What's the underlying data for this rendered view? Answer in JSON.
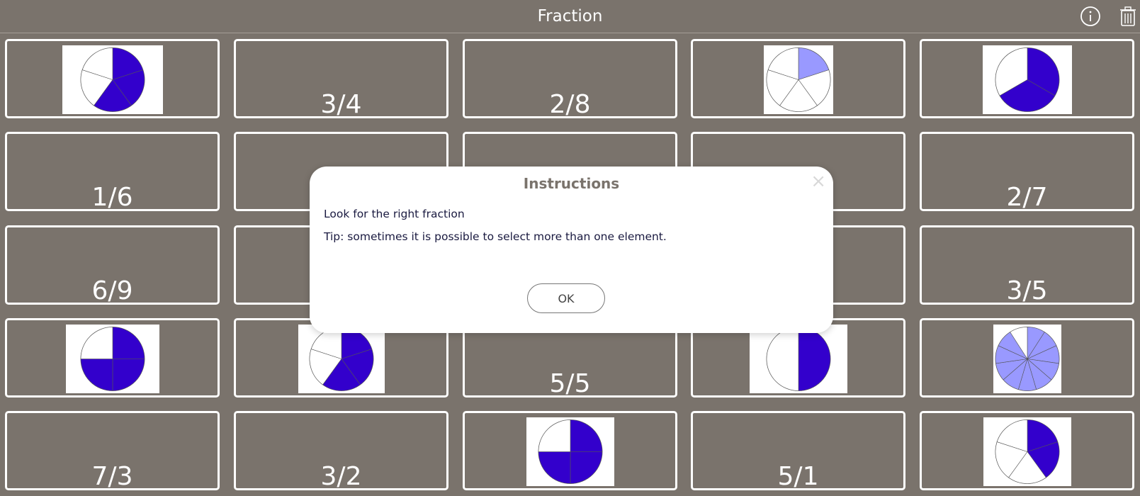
{
  "header": {
    "title": "Fraction",
    "info_icon": "info-icon",
    "trash_icon": "trash-icon"
  },
  "colors": {
    "background": "#7a736c",
    "dark_fill": "#3300cc",
    "light_fill": "#9999ff",
    "card_border": "#ffffff"
  },
  "cards": [
    {
      "kind": "pie",
      "slices": 5,
      "filled": 3,
      "shade": "dark"
    },
    {
      "kind": "text",
      "label": "3/4"
    },
    {
      "kind": "text",
      "label": "2/8"
    },
    {
      "kind": "pie",
      "slices": 5,
      "filled": 1,
      "shade": "light"
    },
    {
      "kind": "pie",
      "slices": 3,
      "filled": 2,
      "shade": "dark"
    },
    {
      "kind": "text",
      "label": "1/6"
    },
    {
      "kind": "text",
      "label": ""
    },
    {
      "kind": "text",
      "label": ""
    },
    {
      "kind": "text",
      "label": ""
    },
    {
      "kind": "text",
      "label": "2/7"
    },
    {
      "kind": "text",
      "label": "6/9"
    },
    {
      "kind": "text",
      "label": ""
    },
    {
      "kind": "text",
      "label": ""
    },
    {
      "kind": "text",
      "label": ""
    },
    {
      "kind": "text",
      "label": "3/5"
    },
    {
      "kind": "pie",
      "slices": 4,
      "filled": 3,
      "shade": "dark"
    },
    {
      "kind": "pie",
      "slices": 5,
      "filled": 3,
      "shade": "dark"
    },
    {
      "kind": "text",
      "label": "5/5"
    },
    {
      "kind": "pie",
      "slices": 2,
      "filled": 1,
      "shade": "dark"
    },
    {
      "kind": "pie",
      "slices": 11,
      "filled": 10,
      "shade": "light"
    },
    {
      "kind": "text",
      "label": "7/3"
    },
    {
      "kind": "text",
      "label": "3/2"
    },
    {
      "kind": "pie",
      "slices": 4,
      "filled": 3,
      "shade": "dark"
    },
    {
      "kind": "text",
      "label": "5/1"
    },
    {
      "kind": "pie",
      "slices": 5,
      "filled": 2,
      "shade": "dark"
    }
  ],
  "modal": {
    "title": "Instructions",
    "close_glyph": "×",
    "line1": "Look for the right fraction",
    "line2": "Tip: sometimes it is possible to select more than one element.",
    "ok_label": "OK"
  }
}
